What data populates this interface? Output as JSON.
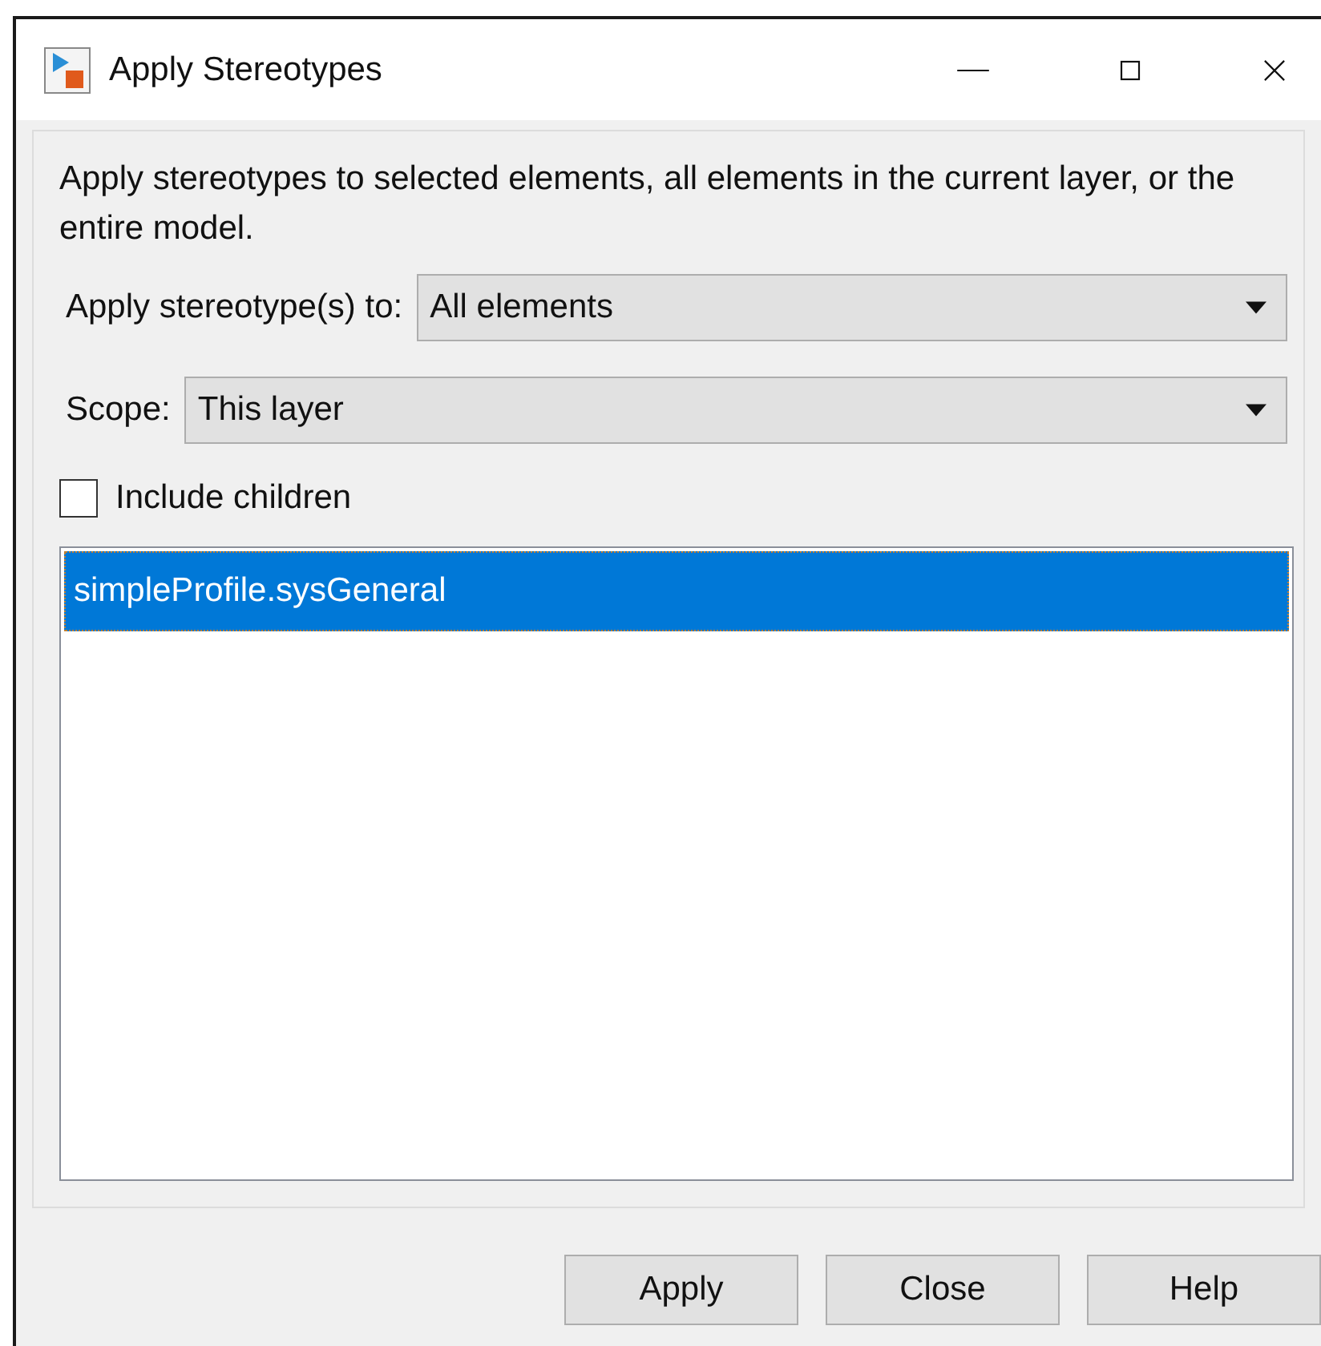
{
  "window": {
    "title": "Apply Stereotypes"
  },
  "description": "Apply stereotypes to selected elements, all elements in the current layer, or the entire model.",
  "dropdowns": [
    {
      "label": "Apply stereotype(s) to:",
      "value": "All elements"
    },
    {
      "label": "Scope:",
      "value": "This layer"
    }
  ],
  "include_children": {
    "label": "Include children",
    "checked": false
  },
  "stereotypes": [
    {
      "label": "simpleProfile.sysGeneral",
      "selected": true
    }
  ],
  "buttons": [
    "Apply",
    "Close",
    "Help"
  ]
}
